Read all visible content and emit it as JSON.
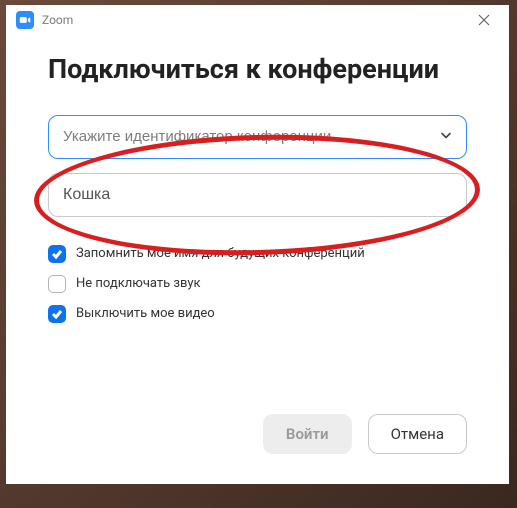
{
  "titlebar": {
    "appName": "Zoom"
  },
  "heading": "Подключиться к конференции",
  "meetingIdField": {
    "placeholder": "Укажите идентификатор конференции ..."
  },
  "nameField": {
    "value": "Кошка"
  },
  "options": {
    "remember": {
      "label": "Запомнить мое имя для будущих конференций",
      "checked": true
    },
    "noAudio": {
      "label": "Не подключать звук",
      "checked": false
    },
    "videoOff": {
      "label": "Выключить мое видео",
      "checked": true
    }
  },
  "buttons": {
    "join": "Войти",
    "cancel": "Отмена"
  }
}
